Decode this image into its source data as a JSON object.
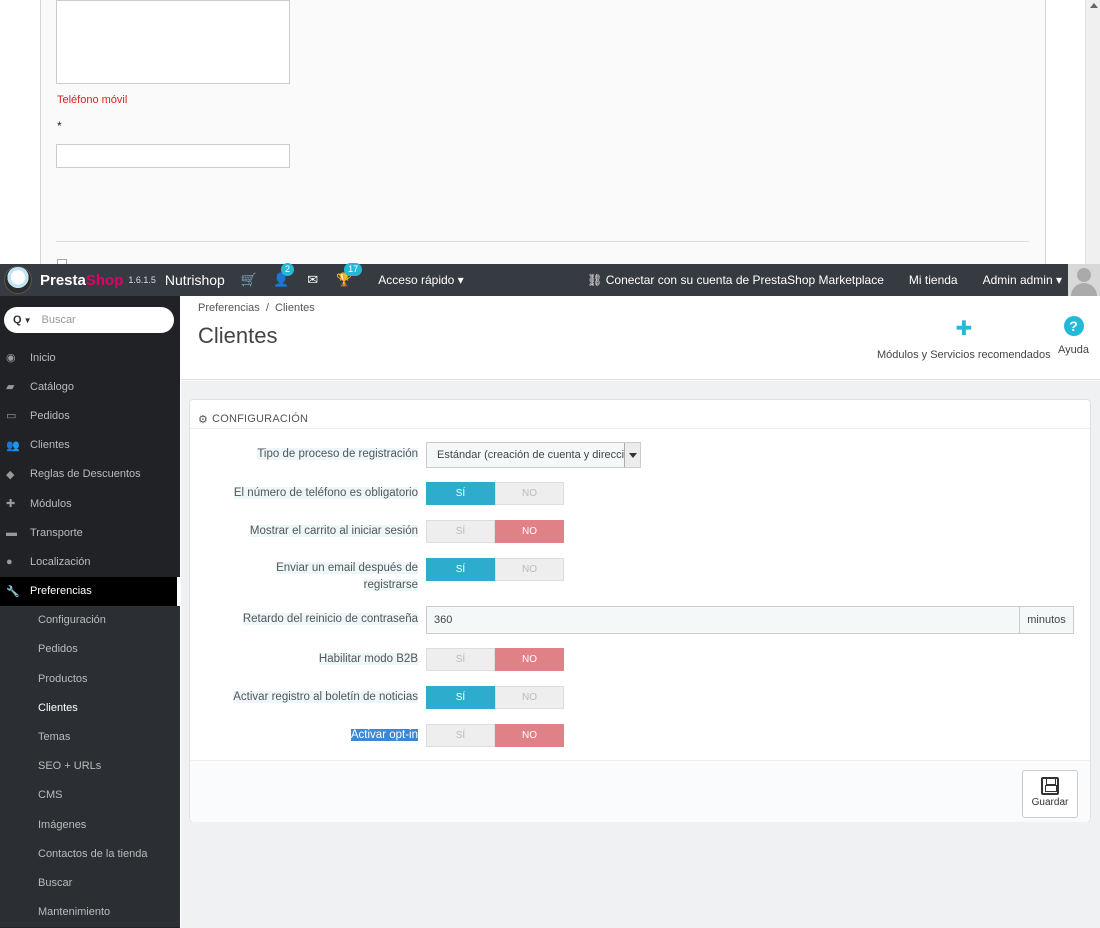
{
  "background_page": {
    "phone_label": "Teléfono móvil",
    "asterisk": "*"
  },
  "header": {
    "brand_pre": "Presta",
    "brand_shop": "Shop",
    "version": "1.6.1.5",
    "shop_name": "Nutrishop",
    "customers_badge": "2",
    "trophy_badge": "17",
    "quick_access": "Acceso rápido ▾",
    "marketplace": "Conectar con su cuenta de PrestaShop Marketplace",
    "my_store": "Mi tienda",
    "admin": "Admin admin ▾"
  },
  "sidebar": {
    "search_placeholder": "Buscar",
    "items": [
      {
        "label": "Inicio",
        "icon": "dashboard-icon"
      },
      {
        "label": "Catálogo",
        "icon": "book-icon"
      },
      {
        "label": "Pedidos",
        "icon": "credit-card-icon"
      },
      {
        "label": "Clientes",
        "icon": "users-icon"
      },
      {
        "label": "Reglas de Descuentos",
        "icon": "tag-icon"
      },
      {
        "label": "Módulos",
        "icon": "puzzle-icon"
      },
      {
        "label": "Transporte",
        "icon": "truck-icon"
      },
      {
        "label": "Localización",
        "icon": "globe-icon"
      },
      {
        "label": "Preferencias",
        "icon": "wrench-icon"
      }
    ],
    "subitems": [
      "Configuración",
      "Pedidos",
      "Productos",
      "Clientes",
      "Temas",
      "SEO + URLs",
      "CMS",
      "Imágenes",
      "Contactos de la tienda",
      "Buscar",
      "Mantenimiento"
    ]
  },
  "page_head": {
    "breadcrumb": "Preferencias  /  Clientes",
    "title": "Clientes",
    "modules_button": "Módulos y Servicios recomendados",
    "help_button": "Ayuda"
  },
  "panel": {
    "heading": "CONFIGURACIÓN",
    "fields": {
      "registration_type": {
        "label": "Tipo de proceso de registración",
        "value": "Estándar (creación de cuenta y direcci"
      },
      "phone_required": {
        "label": "El número de teléfono es obligatorio",
        "yes": "SÍ",
        "no": "NO",
        "selected": "yes"
      },
      "show_cart": {
        "label": "Mostrar el carrito al iniciar sesión",
        "yes": "SÍ",
        "no": "NO",
        "selected": "no"
      },
      "send_email_l1": "Enviar un email después de",
      "send_email_l2": "registrarse",
      "send_email": {
        "yes": "SÍ",
        "no": "NO",
        "selected": "yes"
      },
      "password_delay": {
        "label": "Retardo del reinicio de contraseña",
        "value": "360",
        "unit": "minutos"
      },
      "b2b": {
        "label": "Habilitar modo B2B",
        "yes": "SÍ",
        "no": "NO",
        "selected": "no"
      },
      "newsletter": {
        "label": "Activar registro al boletín de noticias",
        "yes": "SÍ",
        "no": "NO",
        "selected": "yes"
      },
      "optin": {
        "label": "Activar opt-in",
        "yes": "SÍ",
        "no": "NO",
        "selected": "no"
      }
    },
    "save_label": "Guardar"
  },
  "colors": {
    "header_bg": "#363a41",
    "sidebar_bg": "#202226",
    "accent": "#25b9d7",
    "toggle_yes": "#2eacce",
    "toggle_no": "#e08188",
    "brand_shop": "#df0067",
    "required_label": "#e02020"
  }
}
